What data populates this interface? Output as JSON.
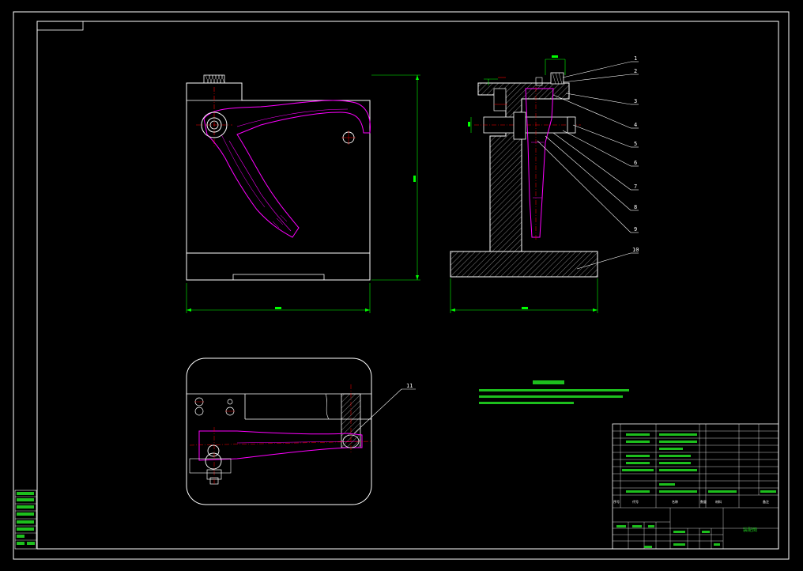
{
  "drawing": {
    "balloons": [
      "1",
      "2",
      "3",
      "4",
      "5",
      "6",
      "7",
      "8",
      "9",
      "10"
    ],
    "top_view_balloon": "11",
    "colors": {
      "background": "#000000",
      "frame": "#ffffff",
      "part_outline": "#ff00ff",
      "dimension": "#00ff00",
      "centerline": "#ff0000",
      "hatch": "#ffffff"
    }
  },
  "title_block": {
    "header": {
      "seq": "序号",
      "code": "代号",
      "name": "名称",
      "qty": "数量",
      "material": "材料",
      "note": "备注"
    },
    "title_text": "装配图"
  }
}
